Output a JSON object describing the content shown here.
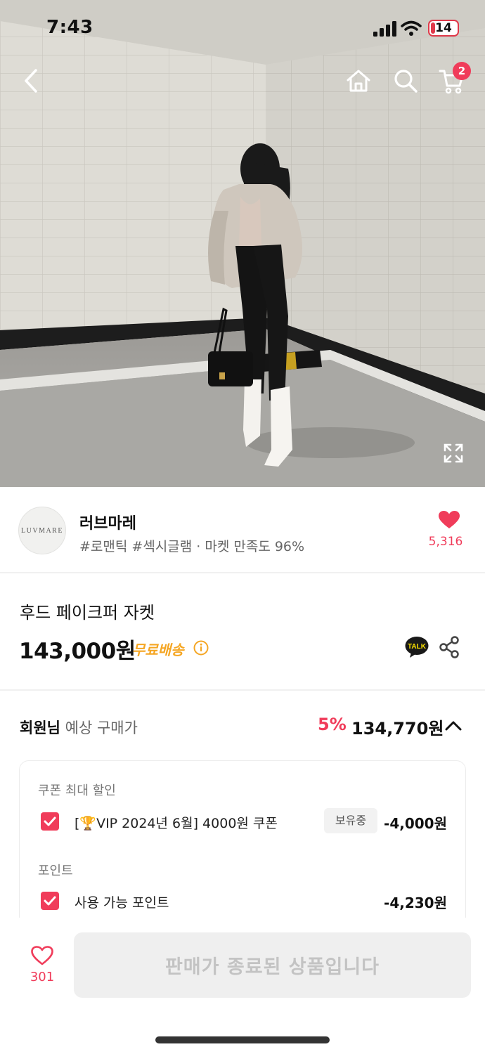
{
  "status_bar": {
    "time": "7:43",
    "battery": "14"
  },
  "nav": {
    "cart_count": "2"
  },
  "store": {
    "logo_text": "LUVMARE",
    "name": "러브마레",
    "tags": "#로맨틱 #섹시글램 · 마켓 만족도 96%",
    "like_count": "5,316"
  },
  "product": {
    "name": "후드 페이크퍼 자켓",
    "price": "143,000원",
    "shipping": "무료배송",
    "talk_label": "TALK"
  },
  "expected_price": {
    "label_bold": "회원님",
    "label": "예상 구매가",
    "discount_rate": "5%",
    "price": "134,770원"
  },
  "benefits": {
    "coupon_title": "쿠폰 최대 할인",
    "coupon": {
      "label": "[🏆VIP 2024년 6월] 4000원 쿠폰",
      "badge": "보유중",
      "amount": "-4,000원",
      "checked": true
    },
    "point_title": "포인트",
    "point": {
      "label": "사용 가능 포인트",
      "amount": "-4,230원",
      "checked": true
    }
  },
  "bottom": {
    "wish_count": "301",
    "status": "판매가 종료된 상품입니다"
  },
  "colors": {
    "accent": "#f03c5a",
    "shipping": "#f5a623",
    "talk": "#fae100"
  }
}
